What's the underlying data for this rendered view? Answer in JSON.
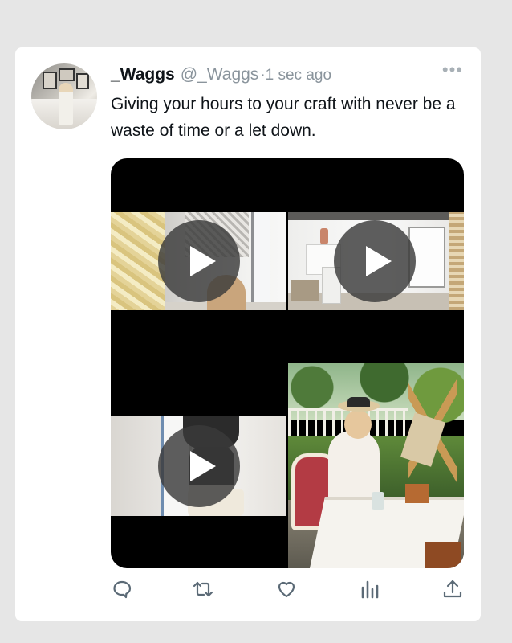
{
  "tweet": {
    "display_name": "_Waggs",
    "handle": "@_Waggs",
    "timestamp": "·1 sec ago",
    "more_label": "•••",
    "text": "Giving your hours to your craft with never be a waste of time or a let down."
  },
  "media": {
    "tiles": [
      {
        "kind": "video",
        "icon": "play-icon"
      },
      {
        "kind": "video",
        "icon": "play-icon"
      },
      {
        "kind": "video",
        "icon": "play-icon"
      },
      {
        "kind": "photo"
      }
    ]
  },
  "actions": [
    {
      "name": "reply",
      "icon": "comment-icon"
    },
    {
      "name": "retweet",
      "icon": "retweet-icon"
    },
    {
      "name": "like",
      "icon": "heart-icon"
    },
    {
      "name": "analytics",
      "icon": "bar-chart-icon"
    },
    {
      "name": "share",
      "icon": "share-icon"
    }
  ],
  "colors": {
    "page_background": "#e6e6e6",
    "card_background": "#ffffff",
    "text_primary": "#0f1419",
    "text_secondary": "#8a949c",
    "icon_color": "#5b6a76"
  }
}
